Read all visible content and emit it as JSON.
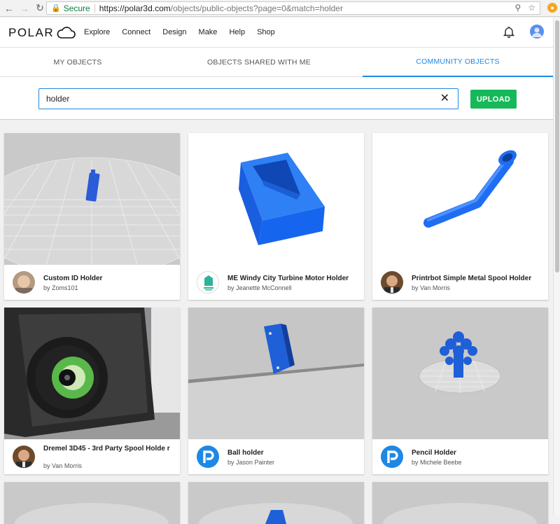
{
  "browser": {
    "secure_label": "Secure",
    "url_host": "https://polar3d.com",
    "url_rest": "/objects/public-objects?page=0&match=holder"
  },
  "header": {
    "logo": "POLAR",
    "nav": [
      "Explore",
      "Connect",
      "Design",
      "Make",
      "Help",
      "Shop"
    ]
  },
  "tabs": [
    {
      "label": "MY OBJECTS"
    },
    {
      "label": "OBJECTS SHARED WITH ME"
    },
    {
      "label": "COMMUNITY OBJECTS",
      "active": true
    }
  ],
  "search": {
    "value": "holder",
    "upload_label": "UPLOAD"
  },
  "objects": [
    {
      "title": "Custom ID Holder",
      "author": "by Zoms101",
      "avatar": "photo-face-icon"
    },
    {
      "title": "ME Windy City Turbine Motor Holder",
      "author": "by Jeanette McConnell",
      "avatar": "makers-logo-icon"
    },
    {
      "title": "Printrbot Simple Metal Spool Holder",
      "author": "by Van Morris",
      "avatar": "photo-face-icon"
    },
    {
      "title": "Dremel 3D45 - 3rd Party Spool Holde r",
      "author": "by Van Morris",
      "avatar": "photo-face-icon"
    },
    {
      "title": "Ball holder",
      "author": "by Jason Painter",
      "avatar": "polar-p-icon"
    },
    {
      "title": "Pencil Holder",
      "author": "by Michele Beebe",
      "avatar": "polar-p-icon"
    }
  ],
  "colors": {
    "accent": "#1e88e5",
    "upload": "#16b85a",
    "model_blue": "#1f6df2"
  }
}
